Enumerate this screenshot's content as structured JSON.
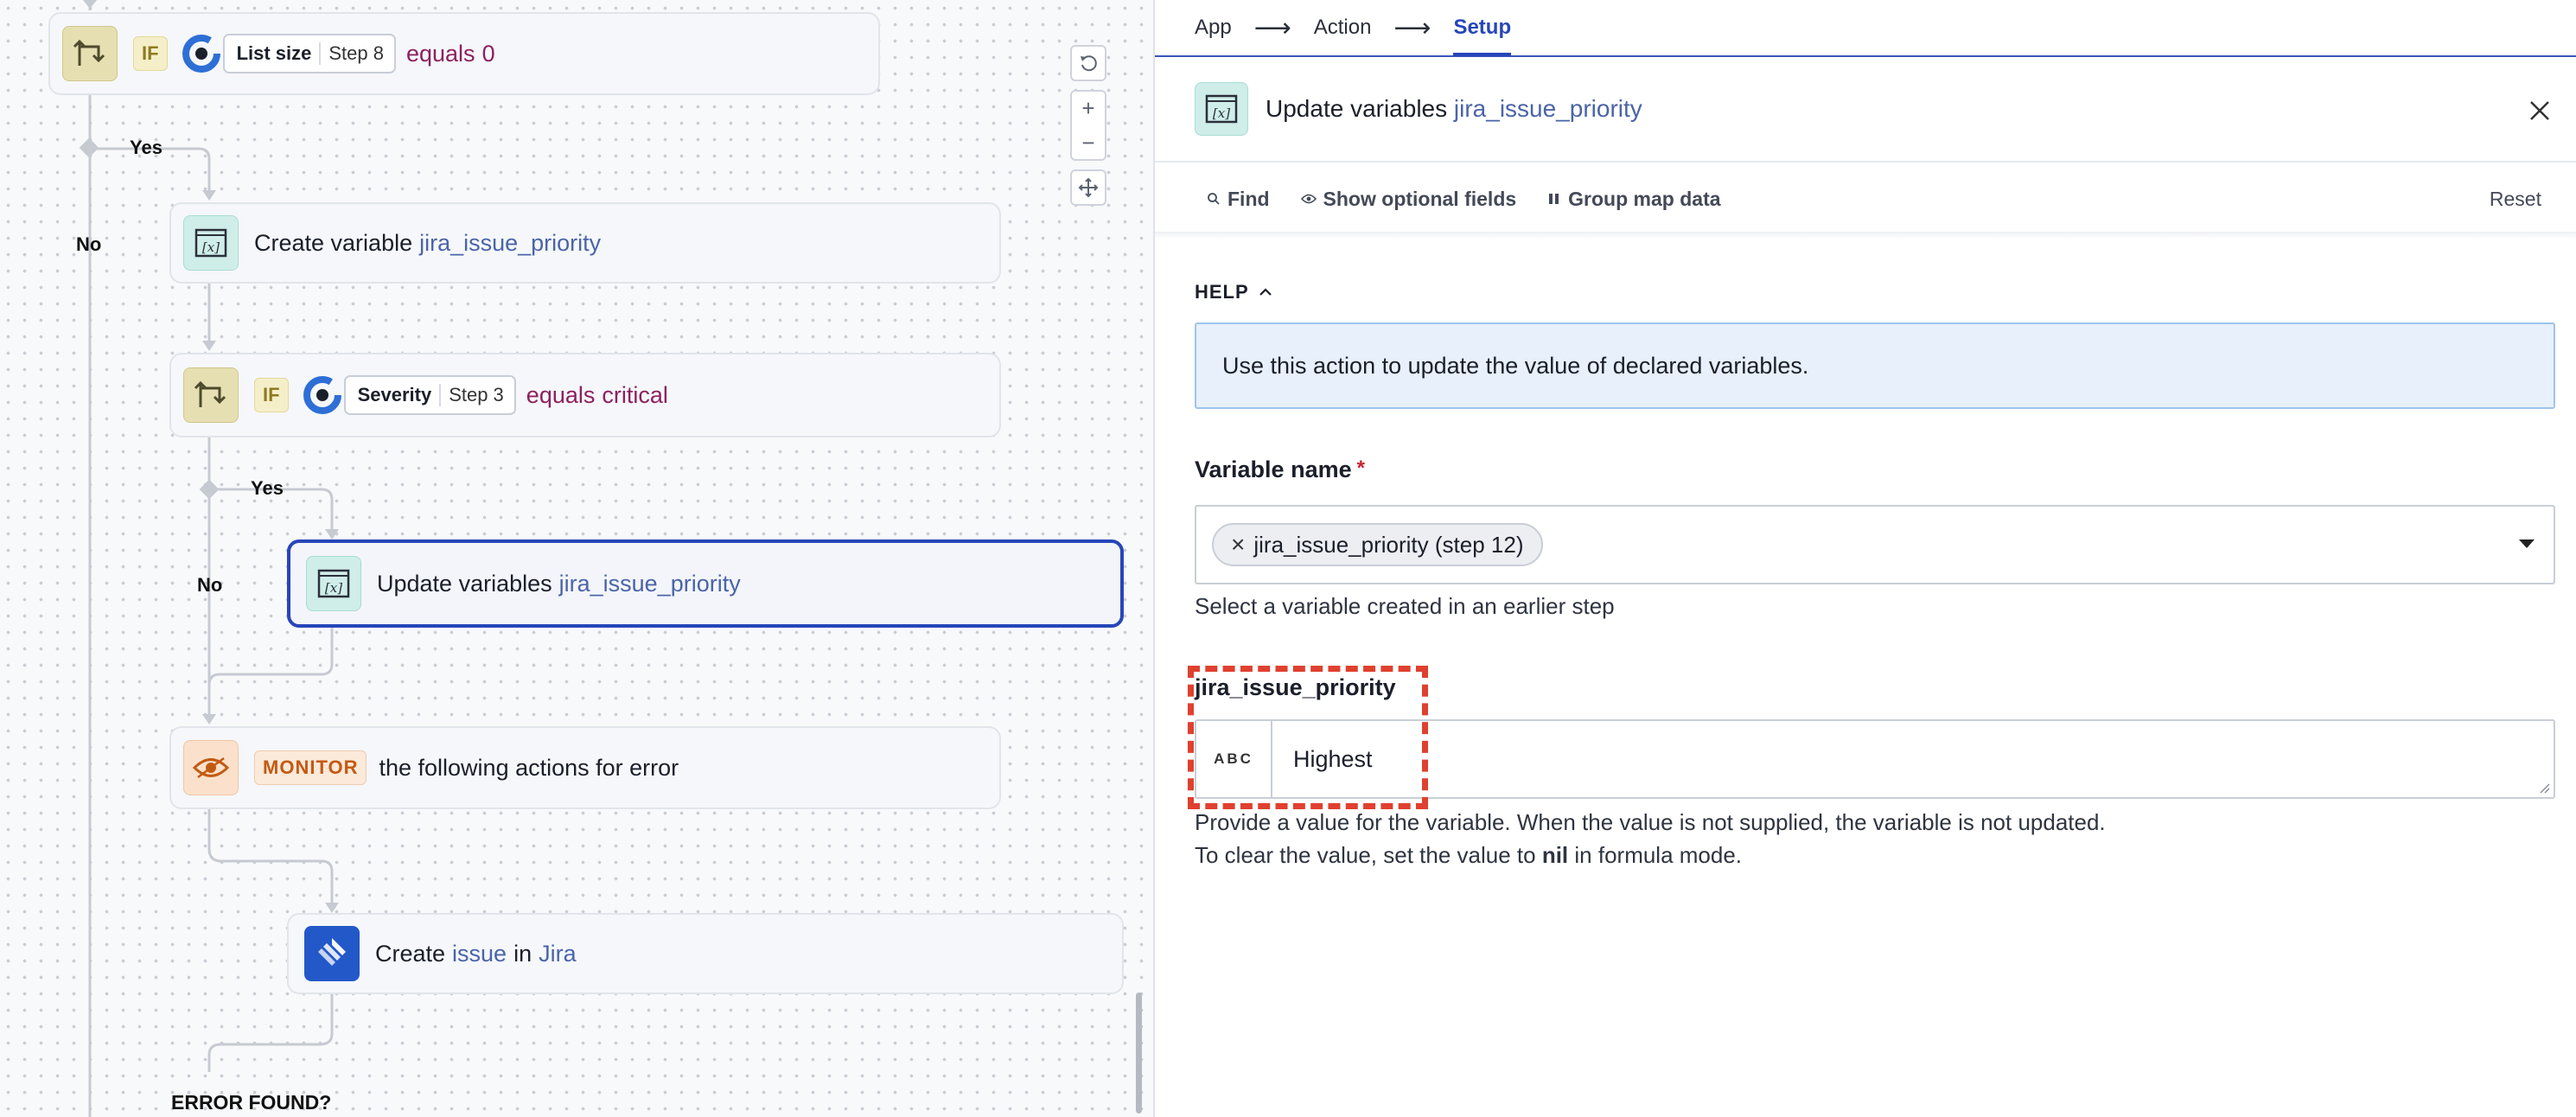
{
  "canvas": {
    "top_if": {
      "badge": "IF",
      "pill_name": "List size",
      "pill_step": "Step 8",
      "op": "equals",
      "value": "0"
    },
    "branch_yes_1": "Yes",
    "branch_no_1": "No",
    "create_var": {
      "label": "Create variable",
      "var": "jira_issue_priority"
    },
    "severity_if": {
      "badge": "IF",
      "pill_name": "Severity",
      "pill_step": "Step 3",
      "op": "equals",
      "value": "critical"
    },
    "branch_yes_2": "Yes",
    "branch_no_2": "No",
    "update_var": {
      "label": "Update variables",
      "var": "jira_issue_priority"
    },
    "monitor": {
      "badge": "MONITOR",
      "text": "the following actions for error"
    },
    "jira": {
      "prefix": "Create",
      "obj": "issue",
      "mid": "in",
      "app": "Jira"
    },
    "error_found": "ERROR FOUND?",
    "controls": {
      "reset": "reset-view",
      "zoom_in": "+",
      "zoom_out": "−",
      "fit": "fit"
    }
  },
  "panel": {
    "tabs": [
      {
        "label": "App"
      },
      {
        "label": "Action"
      },
      {
        "label": "Setup"
      }
    ],
    "active_tab": "Setup",
    "header": {
      "title": "Update variables",
      "var": "jira_issue_priority"
    },
    "toolbar": {
      "find": "Find",
      "optional": "Show optional fields",
      "group": "Group map data",
      "reset": "Reset"
    },
    "help": {
      "heading": "HELP",
      "text": "Use this action to update the value of declared variables."
    },
    "variable_name": {
      "label": "Variable name",
      "required_mark": "*",
      "chip": "jira_issue_priority (step 12)",
      "hint": "Select a variable created in an earlier step"
    },
    "value_field": {
      "label": "jira_issue_priority",
      "type_badge": "ABC",
      "value": "Highest",
      "hint1": "Provide a value for the variable. When the value is not supplied, the variable is not updated.",
      "hint2_a": "To clear the value, set the value to",
      "hint2_b": "nil",
      "hint2_c": "in formula mode."
    }
  },
  "colors": {
    "accent": "#2746b9",
    "purple_value": "#8d2060",
    "link_blue": "#4a64a8",
    "highlight": "#e0402f"
  }
}
